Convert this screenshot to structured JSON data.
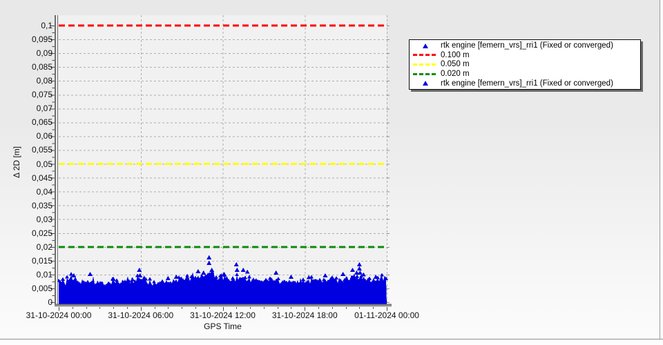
{
  "chart": {
    "y_axis": {
      "title": "Δ 2D [m]",
      "ticks": [
        {
          "label": "0,1",
          "value": 0.1
        },
        {
          "label": "0,095",
          "value": 0.095
        },
        {
          "label": "0,09",
          "value": 0.09
        },
        {
          "label": "0,085",
          "value": 0.085
        },
        {
          "label": "0,08",
          "value": 0.08
        },
        {
          "label": "0,075",
          "value": 0.075
        },
        {
          "label": "0,07",
          "value": 0.07
        },
        {
          "label": "0,065",
          "value": 0.065
        },
        {
          "label": "0,06",
          "value": 0.06
        },
        {
          "label": "0,055",
          "value": 0.055
        },
        {
          "label": "0,05",
          "value": 0.05
        },
        {
          "label": "0,045",
          "value": 0.045
        },
        {
          "label": "0,04",
          "value": 0.04
        },
        {
          "label": "0,035",
          "value": 0.035
        },
        {
          "label": "0,03",
          "value": 0.03
        },
        {
          "label": "0,025",
          "value": 0.025
        },
        {
          "label": "0,02",
          "value": 0.02
        },
        {
          "label": "0,015",
          "value": 0.015
        },
        {
          "label": "0,01",
          "value": 0.01
        },
        {
          "label": "0,005",
          "value": 0.005
        },
        {
          "label": "0",
          "value": 0
        }
      ]
    },
    "x_axis": {
      "title": "GPS Time",
      "ticks": [
        {
          "label": "31-10-2024 00:00",
          "hour": 0
        },
        {
          "label": "31-10-2024 06:00",
          "hour": 6
        },
        {
          "label": "31-10-2024 12:00",
          "hour": 12
        },
        {
          "label": "31-10-2024 18:00",
          "hour": 18
        },
        {
          "label": "01-11-2024 00:00",
          "hour": 24
        }
      ]
    },
    "thresholds": [
      {
        "value": 0.1,
        "color": "#ff0000",
        "label": "0.100 m"
      },
      {
        "value": 0.05,
        "color": "#ffff00",
        "label": "0.050 m"
      },
      {
        "value": 0.02,
        "color": "#0a8c0a",
        "label": "0.020 m"
      }
    ],
    "legend": {
      "items": [
        {
          "type": "marker",
          "icon": "triangle-marker-icon",
          "color": "#0000e0",
          "label": "rtk engine [femern_vrs]_rri1 (Fixed or converged)"
        },
        {
          "type": "dash",
          "icon": "dash-line-icon",
          "color": "#ff0000",
          "label": "0.100 m"
        },
        {
          "type": "dash",
          "icon": "dash-line-icon",
          "color": "#ffff00",
          "label": "0.050 m"
        },
        {
          "type": "dash",
          "icon": "dash-line-icon",
          "color": "#0a8c0a",
          "label": "0.020 m"
        },
        {
          "type": "marker",
          "icon": "triangle-marker-icon",
          "color": "#0000e0",
          "label": "rtk engine [femern_vrs]_rri1 (Fixed or converged)"
        }
      ]
    }
  },
  "chart_data": {
    "type": "scatter",
    "title": "",
    "xlabel": "GPS Time",
    "ylabel": "Δ 2D [m]",
    "x_range": [
      "31-10-2024 00:00",
      "01-11-2024 00:00"
    ],
    "x_tick_interval_hours": 6,
    "ylim": [
      0,
      0.1
    ],
    "y_tick_interval": 0.005,
    "grid": true,
    "legend_position": "top-right",
    "thresholds_m": [
      0.1,
      0.05,
      0.02
    ],
    "series": [
      {
        "name": "rtk engine [femern_vrs]_rri1 (Fixed or converged)",
        "marker": "triangle",
        "color": "#0000e0",
        "description": "Dense scatter of 2D position deltas filling 0 m up to an envelope of ~0.006-0.010 m across 24 h, with isolated outlier points listed below.",
        "envelope_hours": [
          0,
          0.5,
          1,
          1.5,
          2,
          2.5,
          3,
          3.5,
          4,
          4.5,
          5,
          5.5,
          6,
          6.5,
          7,
          7.5,
          8,
          8.5,
          9,
          9.5,
          10,
          10.5,
          11,
          11.5,
          12,
          12.5,
          13,
          13.5,
          14,
          14.5,
          15,
          15.5,
          16,
          16.5,
          17,
          17.5,
          18,
          18.5,
          19,
          19.5,
          20,
          20.5,
          21,
          21.5,
          22,
          22.5,
          23,
          23.5,
          24
        ],
        "envelope_max_m": [
          0.0082,
          0.007,
          0.0074,
          0.0068,
          0.0066,
          0.0071,
          0.0067,
          0.0064,
          0.0072,
          0.0069,
          0.0078,
          0.0072,
          0.008,
          0.0074,
          0.007,
          0.0076,
          0.0072,
          0.0078,
          0.0082,
          0.0088,
          0.0084,
          0.0092,
          0.01,
          0.0088,
          0.0085,
          0.0082,
          0.0086,
          0.009,
          0.0082,
          0.0078,
          0.0075,
          0.008,
          0.0076,
          0.0072,
          0.0076,
          0.007,
          0.0074,
          0.0078,
          0.0072,
          0.0076,
          0.0082,
          0.0078,
          0.0084,
          0.008,
          0.0086,
          0.0082,
          0.0078,
          0.0085,
          0.009
        ],
        "outliers": [
          [
            1.1,
            0.0105
          ],
          [
            2.3,
            0.011
          ],
          [
            4.0,
            0.0092
          ],
          [
            5.4,
            0.009
          ],
          [
            5.9,
            0.0125
          ],
          [
            5.95,
            0.0105
          ],
          [
            8.0,
            0.0095
          ],
          [
            8.6,
            0.01
          ],
          [
            10.2,
            0.012
          ],
          [
            10.6,
            0.0115
          ],
          [
            11.0,
            0.017
          ],
          [
            11.0,
            0.015
          ],
          [
            11.2,
            0.0125
          ],
          [
            12.1,
            0.011
          ],
          [
            13.0,
            0.0145
          ],
          [
            13.05,
            0.0125
          ],
          [
            13.5,
            0.0125
          ],
          [
            13.8,
            0.0118
          ],
          [
            15.9,
            0.0115
          ],
          [
            17.0,
            0.01
          ],
          [
            18.3,
            0.0098
          ],
          [
            19.5,
            0.0105
          ],
          [
            20.8,
            0.011
          ],
          [
            21.5,
            0.0125
          ],
          [
            21.8,
            0.0115
          ],
          [
            22.0,
            0.0145
          ],
          [
            22.0,
            0.013
          ],
          [
            22.05,
            0.0115
          ],
          [
            22.3,
            0.0108
          ],
          [
            23.2,
            0.01
          ]
        ]
      }
    ]
  }
}
